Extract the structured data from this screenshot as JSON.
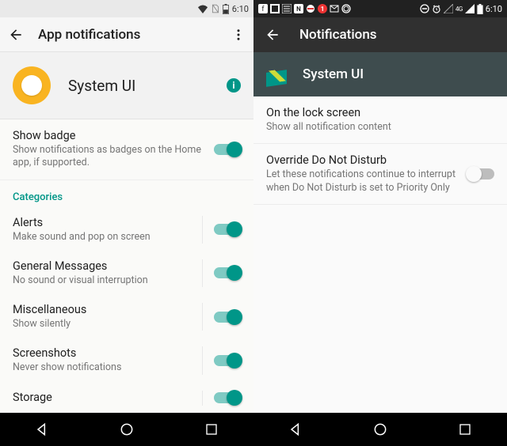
{
  "left": {
    "status": {
      "time": "6:10"
    },
    "appbar": {
      "title": "App notifications"
    },
    "app": {
      "name": "System UI"
    },
    "showBadge": {
      "title": "Show badge",
      "subtitle": "Show notifications as badges on the Home app, if supported."
    },
    "categoriesLabel": "Categories",
    "categories": [
      {
        "title": "Alerts",
        "subtitle": "Make sound and pop on screen"
      },
      {
        "title": "General Messages",
        "subtitle": "No sound or visual interruption"
      },
      {
        "title": "Miscellaneous",
        "subtitle": "Show silently"
      },
      {
        "title": "Screenshots",
        "subtitle": "Never show notifications"
      },
      {
        "title": "Storage",
        "subtitle": ""
      }
    ]
  },
  "right": {
    "status": {
      "network": "4G",
      "time": "6:10"
    },
    "appbar": {
      "title": "Notifications"
    },
    "app": {
      "name": "System UI"
    },
    "lockscreen": {
      "title": "On the lock screen",
      "subtitle": "Show all notification content"
    },
    "override": {
      "title": "Override Do Not Disturb",
      "subtitle": "Let these notifications continue to interrupt when Do Not Disturb is set to Priority Only"
    }
  }
}
